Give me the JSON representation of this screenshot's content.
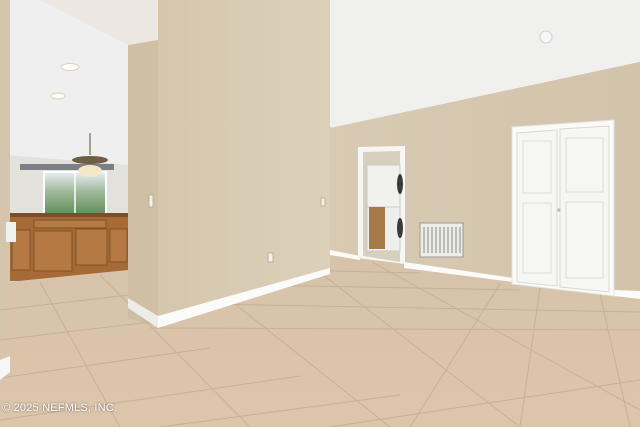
{
  "photo": {
    "subject": "empty-room-interior",
    "watermark_text": "© 2025 NEFMLS, INC."
  },
  "colors": {
    "wall": "#d9ccb5",
    "wall_shadow": "#c7b89e",
    "ceiling": "#f2f2f1",
    "floor_tile": "#d8c2a8",
    "grout": "#c4ab8e",
    "baseboard": "#fbfbf9",
    "cabinet_wood": "#a56a36",
    "door_white": "#f6f6f4"
  }
}
